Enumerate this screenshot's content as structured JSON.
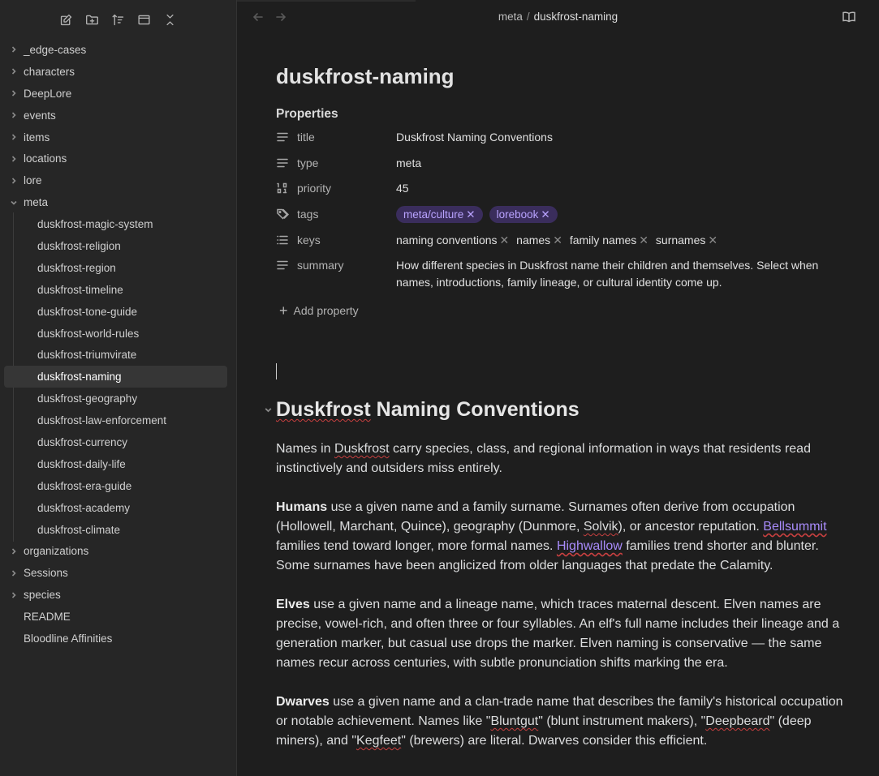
{
  "sidebar": {
    "toolbar": [
      "new-note-icon",
      "new-folder-icon",
      "sort-icon",
      "collapse-view-icon",
      "collapse-all-icon"
    ],
    "folders_top": [
      "_edge-cases",
      "characters",
      "DeepLore",
      "events",
      "items",
      "locations",
      "lore"
    ],
    "open_folder": "meta",
    "meta_children": [
      "duskfrost-magic-system",
      "duskfrost-religion",
      "duskfrost-region",
      "duskfrost-timeline",
      "duskfrost-tone-guide",
      "duskfrost-world-rules",
      "duskfrost-triumvirate",
      "duskfrost-naming",
      "duskfrost-geography",
      "duskfrost-law-enforcement",
      "duskfrost-currency",
      "duskfrost-daily-life",
      "duskfrost-era-guide",
      "duskfrost-academy",
      "duskfrost-climate"
    ],
    "active_index": 7,
    "folders_bottom": [
      "organizations",
      "Sessions",
      "species"
    ],
    "root_files": [
      "README",
      "Bloodline Affinities"
    ]
  },
  "header": {
    "breadcrumb_parent": "meta",
    "breadcrumb_sep": "/",
    "breadcrumb_current": "duskfrost-naming"
  },
  "note": {
    "title": "duskfrost-naming",
    "properties_label": "Properties",
    "properties": {
      "title": {
        "key": "title",
        "value": "Duskfrost Naming Conventions"
      },
      "type": {
        "key": "type",
        "value": "meta"
      },
      "priority": {
        "key": "priority",
        "value": "45"
      },
      "tags": {
        "key": "tags",
        "values": [
          "meta/culture",
          "lorebook"
        ]
      },
      "keys": {
        "key": "keys",
        "values": [
          "naming conventions",
          "names",
          "family names",
          "surnames"
        ]
      },
      "summary": {
        "key": "summary",
        "value": "How different species in Duskfrost name their children and themselves. Select when names, introductions, family lineage, or cultural identity come up."
      }
    },
    "add_property": "Add property",
    "heading": {
      "pre": "",
      "spell": "Duskfrost",
      "post": " Naming Conventions"
    },
    "paragraphs": {
      "p1": {
        "a": "Names in ",
        "b": "Duskfrost",
        "c": " carry species, class, and regional information in ways that residents read instinctively and outsiders miss entirely."
      },
      "p2": {
        "bold": "Humans",
        "a": " use a given name and a family surname. Surnames often derive from occupation (Hollowell, Marchant, Quince), geography (Dunmore, ",
        "spell": "Solvik",
        "b": "), or ancestor reputation. ",
        "link1": "Bellsummit",
        "c": " families tend toward longer, more formal names. ",
        "link2": "Highwallow",
        "d": " families trend shorter and blunter. Some surnames have been anglicized from older languages that predate the Calamity."
      },
      "p3": {
        "bold": "Elves",
        "a": " use a given name and a lineage name, which traces maternal descent. Elven names are precise, vowel-rich, and often three or four syllables. An elf's full name includes their lineage and a generation marker, but casual use drops the marker. Elven naming is conservative — the same names recur across centuries, with subtle pronunciation shifts marking the era."
      },
      "p4": {
        "bold": "Dwarves",
        "a": " use a given name and a clan-trade name that describes the family's historical occupation or notable achievement. Names like \"",
        "s1": "Bluntgut",
        "b": "\" (blunt instrument makers), \"",
        "s2": "Deepbeard",
        "c": "\" (deep miners), and \"",
        "s3": "Kegfeet",
        "d": "\" (brewers) are literal. Dwarves consider this efficient."
      }
    }
  },
  "colors": {
    "accent": "#a88bfa",
    "tag_bg": "#3a2d5c",
    "spellcheck": "#c94040"
  }
}
